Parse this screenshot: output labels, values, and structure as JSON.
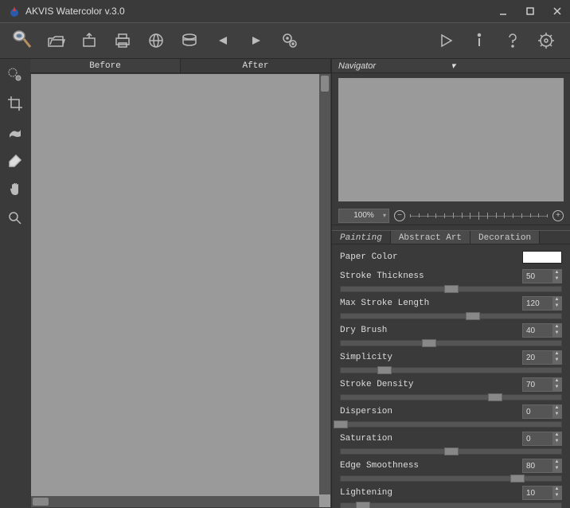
{
  "title": "AKVIS Watercolor v.3.0",
  "tabs": {
    "before": "Before",
    "after": "After"
  },
  "navigator": {
    "label": "Navigator"
  },
  "zoom": {
    "value": "100%"
  },
  "panelTabs": {
    "painting": "Painting",
    "abstract": "Abstract Art",
    "decoration": "Decoration"
  },
  "params": {
    "paperColor": {
      "label": "Paper Color"
    },
    "strokeThickness": {
      "label": "Stroke Thickness",
      "value": "50",
      "pct": 50
    },
    "maxStrokeLength": {
      "label": "Max Stroke Length",
      "value": "120",
      "pct": 60
    },
    "dryBrush": {
      "label": "Dry Brush",
      "value": "40",
      "pct": 40
    },
    "simplicity": {
      "label": "Simplicity",
      "value": "20",
      "pct": 20
    },
    "strokeDensity": {
      "label": "Stroke Density",
      "value": "70",
      "pct": 70
    },
    "dispersion": {
      "label": "Dispersion",
      "value": "0",
      "pct": 0
    },
    "saturation": {
      "label": "Saturation",
      "value": "0",
      "pct": 50
    },
    "edgeSmoothness": {
      "label": "Edge Smoothness",
      "value": "80",
      "pct": 80
    },
    "lightening": {
      "label": "Lightening",
      "value": "10",
      "pct": 10
    }
  }
}
